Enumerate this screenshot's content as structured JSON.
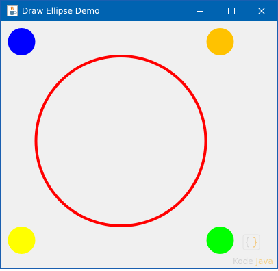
{
  "window": {
    "title": "Draw Ellipse Demo",
    "titlebar_color": "#0063b1",
    "background_color": "#f0f0f0"
  },
  "titlebar": {
    "icon": "java-coffee-cup-icon",
    "buttons": [
      "minimize-icon",
      "maximize-icon",
      "close-icon"
    ]
  },
  "canvas": {
    "shapes": [
      {
        "name": "blue-filled-circle",
        "color": "#0000ff"
      },
      {
        "name": "orange-filled-circle",
        "color": "#ffc200"
      },
      {
        "name": "red-outlined-circle",
        "color": "#ff0000"
      },
      {
        "name": "yellow-filled-circle",
        "color": "#ffff00"
      },
      {
        "name": "green-filled-circle",
        "color": "#00ff00"
      }
    ]
  },
  "watermark": {
    "word1": "Kode",
    "word2": "Java",
    "icon": "curly-braces-logo"
  }
}
